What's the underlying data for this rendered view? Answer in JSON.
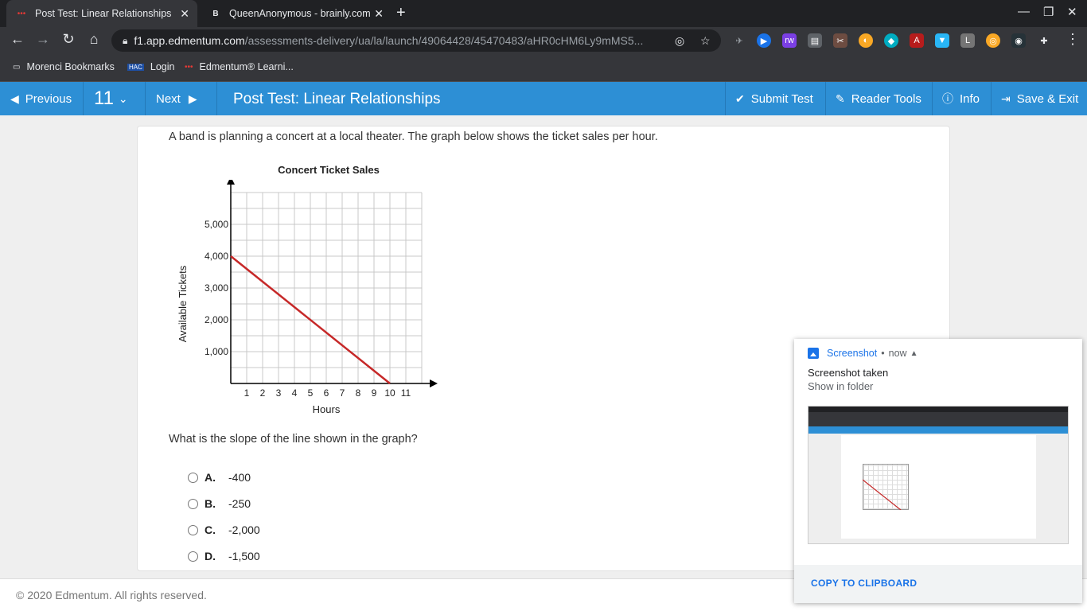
{
  "browser": {
    "tabs": [
      {
        "title": "Post Test: Linear Relationships",
        "active": true
      },
      {
        "title": "QueenAnonymous - brainly.com",
        "active": false
      }
    ],
    "url_host": "f1.app.edmentum.com",
    "url_path": "/assessments-delivery/ua/la/launch/49064428/45470483/aHR0cHM6Ly9mMS5...",
    "bookmarks": [
      "Morenci Bookmarks",
      "Login",
      "Edmentum® Learni..."
    ],
    "extension_icons": [
      "play-extension-icon",
      "rw-extension-icon",
      "docs-extension-icon",
      "scissors-extension-icon",
      "compass-extension-icon",
      "shield-extension-icon",
      "pdf-extension-icon",
      "bookmark-extension-icon",
      "l-extension-icon",
      "coin-extension-icon",
      "dark-extension-icon",
      "puzzle-icon"
    ]
  },
  "header": {
    "previous_label": "Previous",
    "question_number": "11",
    "next_label": "Next",
    "title": "Post Test: Linear Relationships",
    "submit_label": "Submit Test",
    "reader_tools_label": "Reader Tools",
    "info_label": "Info",
    "save_exit_label": "Save & Exit",
    "accent_color": "#2d8fd5"
  },
  "question": {
    "prompt": "A band is planning a concert at a local theater. The graph below shows the ticket sales per hour.",
    "ask": "What is the slope of the line shown in the graph?",
    "options": [
      {
        "letter": "A.",
        "value": "-400"
      },
      {
        "letter": "B.",
        "value": "-250"
      },
      {
        "letter": "C.",
        "value": "-2,000"
      },
      {
        "letter": "D.",
        "value": "-1,500"
      }
    ]
  },
  "chart_data": {
    "type": "line",
    "title": "Concert Ticket Sales",
    "xlabel": "Hours",
    "ylabel": "Available Tickets",
    "x_axis_var": "x",
    "y_axis_var": "y",
    "xlim": [
      0,
      12
    ],
    "ylim": [
      0,
      6000
    ],
    "x_ticks": [
      1,
      2,
      3,
      4,
      5,
      6,
      7,
      8,
      9,
      10,
      11
    ],
    "y_ticks": [
      1000,
      2000,
      3000,
      4000,
      5000
    ],
    "y_tick_labels": [
      "1,000",
      "2,000",
      "3,000",
      "4,000",
      "5,000"
    ],
    "grid": true,
    "series": [
      {
        "x": [
          0,
          10
        ],
        "y": [
          4000,
          0
        ],
        "color": "#c62828"
      }
    ]
  },
  "footer": {
    "copyright": "© 2020 Edmentum. All rights reserved."
  },
  "notification": {
    "app": "Screenshot",
    "time": "now",
    "title": "Screenshot taken",
    "subtitle": "Show in folder",
    "action": "COPY TO CLIPBOARD"
  }
}
